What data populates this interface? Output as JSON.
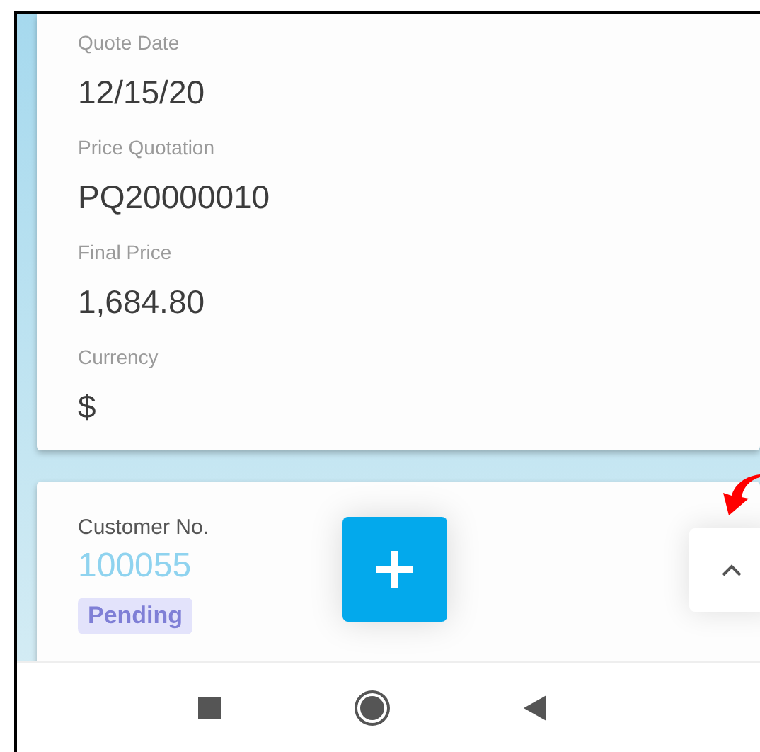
{
  "quote_card": {
    "fields": [
      {
        "label": "Quote Date",
        "value": "12/15/20"
      },
      {
        "label": "Price Quotation",
        "value": "PQ20000010"
      },
      {
        "label": "Final Price",
        "value": "1,684.80"
      },
      {
        "label": "Currency",
        "value": "$"
      }
    ]
  },
  "customer_card": {
    "label": "Customer No.",
    "value": "100055",
    "status": "Pending"
  }
}
